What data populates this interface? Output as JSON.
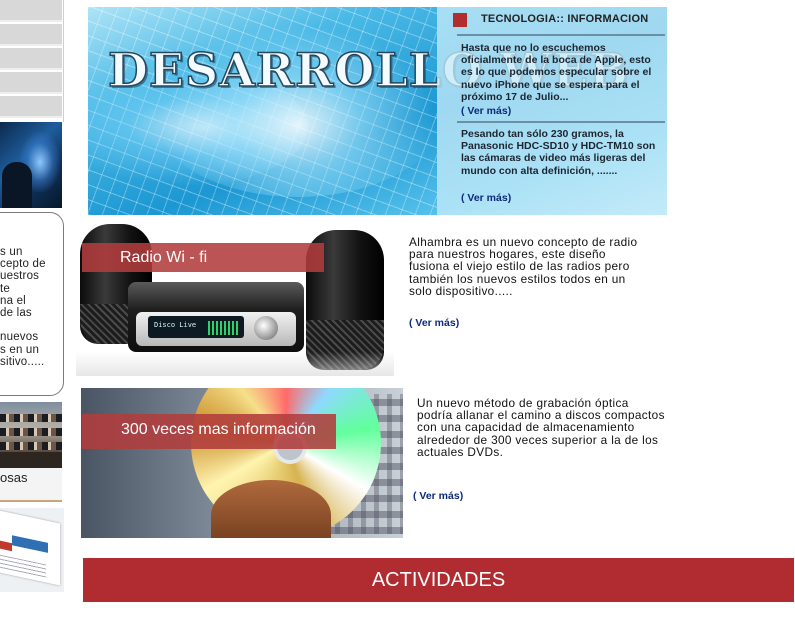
{
  "sidebar": {
    "text_fragment": "s un\ncepto de\nuestros\nte\nna el\nde las\n\nnuevos\ns en un\nsitivo.....",
    "caption": "osas"
  },
  "banner": {
    "title": "DESARROLLO WEB"
  },
  "news": {
    "heading": "TECNOLOGIA:: INFORMACION",
    "items": [
      {
        "text": "Hasta que no lo escuchemos oficialmente de la boca de Apple, esto es lo que podemos especular sobre el nuevo iPhone que se espera para el próximo 17 de Julio...",
        "link": "( Ver más)"
      },
      {
        "text": "Pesando tan sólo 230 gramos, la Panasonic HDC-SD10 y HDC-TM10 son las cámaras de video más ligeras del mundo con alta definición, .......",
        "link": "( Ver más)"
      }
    ]
  },
  "products": [
    {
      "label": "Radio Wi  - fi",
      "description": "Alhambra es un nuevo concepto de radio para nuestros hogares, este diseño fusiona el viejo estilo de las radios pero también los nuevos estilos todos en un solo dispositivo.....",
      "link": "( Ver más)",
      "display_text": "Disco Live"
    },
    {
      "label": "300 veces mas información",
      "description": "Un nuevo método de grabación óptica podría allanar el camino a discos compactos con una capacidad de almacenamiento alrededor de 300 veces superior a la de los actuales DVDs.",
      "link": "( Ver más)"
    }
  ],
  "activities": {
    "label": "ACTIVIDADES"
  },
  "colors": {
    "accent_red": "#b02c30",
    "link_blue": "#0b2a7a",
    "banner_blue": "#1b97d2"
  }
}
